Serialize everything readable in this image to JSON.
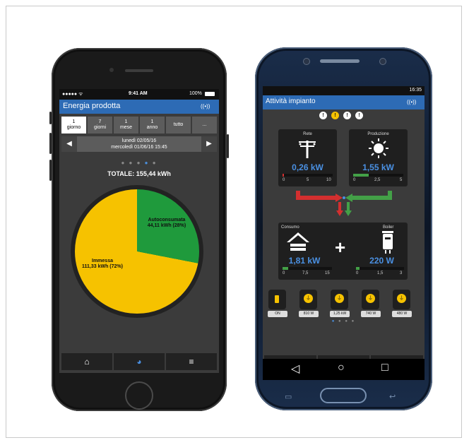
{
  "iphone": {
    "status": {
      "carrier": "●●●●● ᯤ",
      "time": "9:41 AM",
      "battery": "100%"
    },
    "title": "Energia prodotta",
    "signal_icon": "((•))",
    "segments": [
      {
        "l1": "1",
        "l2": "giorno"
      },
      {
        "l1": "7",
        "l2": "giorni"
      },
      {
        "l1": "1",
        "l2": "mese"
      },
      {
        "l1": "1",
        "l2": "anno"
      },
      {
        "l1": "tutto",
        "l2": ""
      },
      {
        "l1": "...",
        "l2": ""
      }
    ],
    "date_line1": "lunedì 02/05/16",
    "date_line2": "mercoledì 01/06/16 15:45",
    "totale": "TOTALE: 155,44 kWh",
    "pie": {
      "autoconsumata_label": "Autoconsumata",
      "autoconsumata_value": "44,11 kWh (28%)",
      "immessa_label": "Immessa",
      "immessa_value": "111,33 kWh (72%)",
      "autoconsumata_pct": 28,
      "immessa_pct": 72,
      "colors": {
        "autoconsumata": "#1f9a3c",
        "immessa": "#f6c200"
      }
    },
    "nav": [
      "home-icon",
      "pie-chart-icon",
      "menu-icon"
    ]
  },
  "galaxy": {
    "status_time": "16:35",
    "title": "Attività impianto",
    "signal_icon": "((•))",
    "warnings": [
      "!",
      "!",
      "!",
      "!"
    ],
    "rete": {
      "label": "Rete",
      "value": "0,26 kW",
      "scale": [
        "0",
        "5",
        "10"
      ],
      "level": 0.026
    },
    "produzione": {
      "label": "Produzione",
      "value": "1,55 kW",
      "scale": [
        "0",
        "2,5",
        "5"
      ],
      "level": 0.31
    },
    "consumo": {
      "label": "Consumo",
      "value": "1,81 kW",
      "scale": [
        "0",
        "7,5",
        "15"
      ],
      "level": 0.12
    },
    "boiler": {
      "label": "Boiler",
      "value": "220 W",
      "scale": [
        "0",
        "1,5",
        "3"
      ],
      "level": 0.07
    },
    "plus": "+",
    "devices": [
      "ON",
      "810 W",
      "1,25 kW",
      "740 W",
      "480 W"
    ],
    "accent": "#4a90e2"
  }
}
